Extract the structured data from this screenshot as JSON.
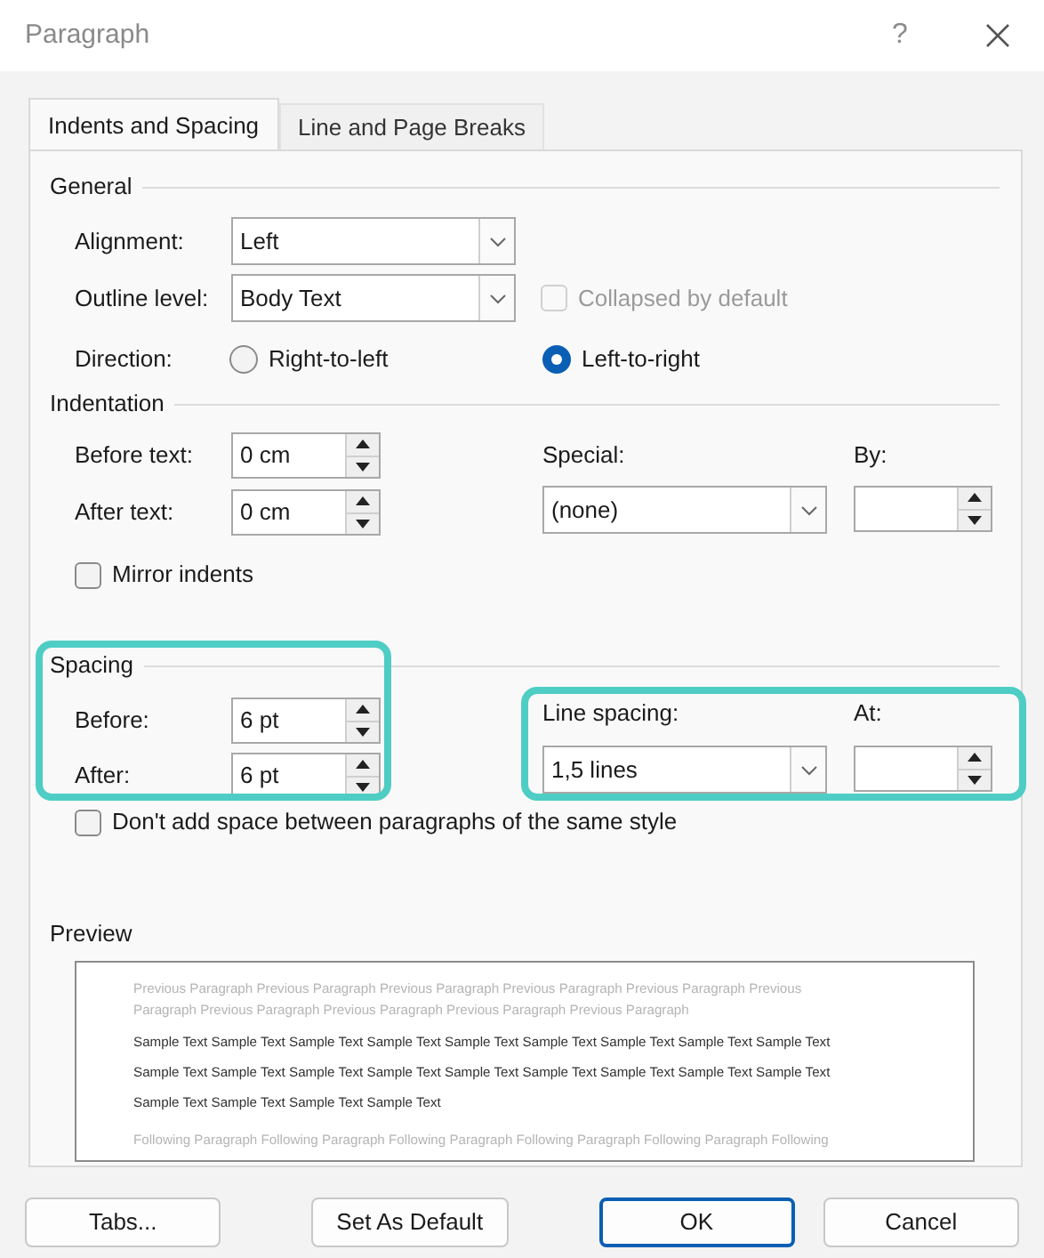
{
  "window": {
    "title": "Paragraph",
    "help": "?"
  },
  "tabs": [
    {
      "label": "Indents and Spacing",
      "selected": true
    },
    {
      "label": "Line and Page Breaks",
      "selected": false
    }
  ],
  "general": {
    "heading": "General",
    "alignment": {
      "label": "Alignment:",
      "value": "Left"
    },
    "outline_level": {
      "label": "Outline level:",
      "value": "Body Text"
    },
    "collapsed_by_default": {
      "label": "Collapsed by default",
      "checked": false,
      "disabled": true
    },
    "direction": {
      "label": "Direction:",
      "options": [
        {
          "label": "Right-to-left",
          "selected": false
        },
        {
          "label": "Left-to-right",
          "selected": true
        }
      ]
    }
  },
  "indentation": {
    "heading": "Indentation",
    "before_text": {
      "label": "Before text:",
      "value": "0 cm"
    },
    "after_text": {
      "label": "After text:",
      "value": "0 cm"
    },
    "special": {
      "label": "Special:",
      "value": "(none)"
    },
    "by": {
      "label": "By:"
    },
    "mirror_indents": {
      "label": "Mirror indents",
      "checked": false
    }
  },
  "spacing": {
    "heading": "Spacing",
    "highlighted": true,
    "before": {
      "label": "Before:",
      "value": "6 pt"
    },
    "after": {
      "label": "After:",
      "value": "6 pt"
    }
  },
  "line_spacing": {
    "highlighted": true,
    "label": "Line spacing:",
    "value": "1,5 lines",
    "at": {
      "label": "At:"
    }
  },
  "dont_add_space": {
    "label": "Don't add space between paragraphs of the same style",
    "checked": false
  },
  "preview": {
    "heading": "Preview",
    "previous_lines": [
      "Previous Paragraph Previous Paragraph Previous Paragraph Previous Paragraph Previous Paragraph Previous",
      "Paragraph Previous Paragraph Previous Paragraph Previous Paragraph Previous Paragraph"
    ],
    "sample_lines": [
      "Sample Text Sample Text Sample Text Sample Text Sample Text Sample Text Sample Text Sample Text Sample Text",
      "Sample Text Sample Text Sample Text Sample Text Sample Text Sample Text Sample Text Sample Text Sample Text",
      "Sample Text Sample Text Sample Text Sample Text"
    ],
    "following_lines": [
      "Following Paragraph Following Paragraph Following Paragraph Following Paragraph Following Paragraph Following"
    ]
  },
  "buttons": [
    {
      "label": "Tabs...",
      "default": false
    },
    {
      "label": "Set As Default",
      "default": false
    },
    {
      "label": "OK",
      "default": true
    },
    {
      "label": "Cancel",
      "default": false
    }
  ]
}
